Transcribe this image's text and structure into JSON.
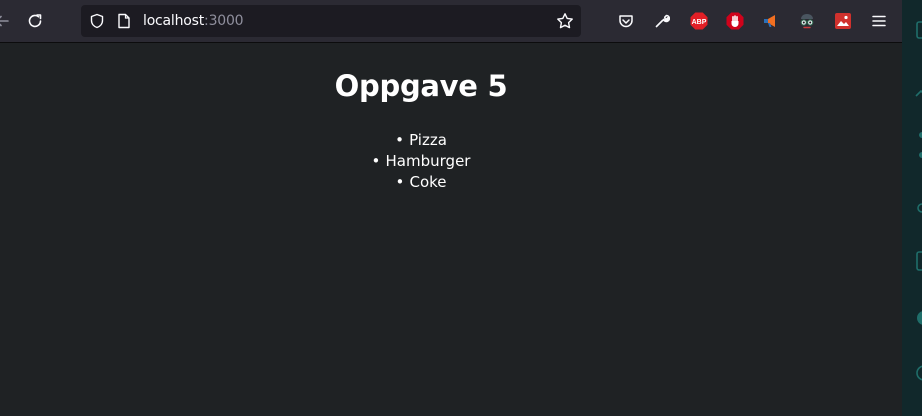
{
  "browser": {
    "url_host": "localhost",
    "url_port": ":3000",
    "extensions": {
      "abp_label": "ABP"
    }
  },
  "page": {
    "title": "Oppgave 5",
    "items": [
      "Pizza",
      "Hamburger",
      "Coke"
    ]
  },
  "icons": {
    "back": "back-arrow-icon",
    "reload": "reload-icon",
    "shield": "shield-icon",
    "page": "page-icon",
    "star": "star-icon",
    "pocket": "pocket-icon",
    "wrench": "wrench-icon",
    "menu": "hamburger-menu-icon"
  },
  "colors": {
    "toolbar": "#2b2a33",
    "urlbar": "#1c1b22",
    "page_background": "#1f2224",
    "sidebar": "#11282b",
    "abp_red": "#e21f26",
    "stop_red": "#d0021b"
  }
}
